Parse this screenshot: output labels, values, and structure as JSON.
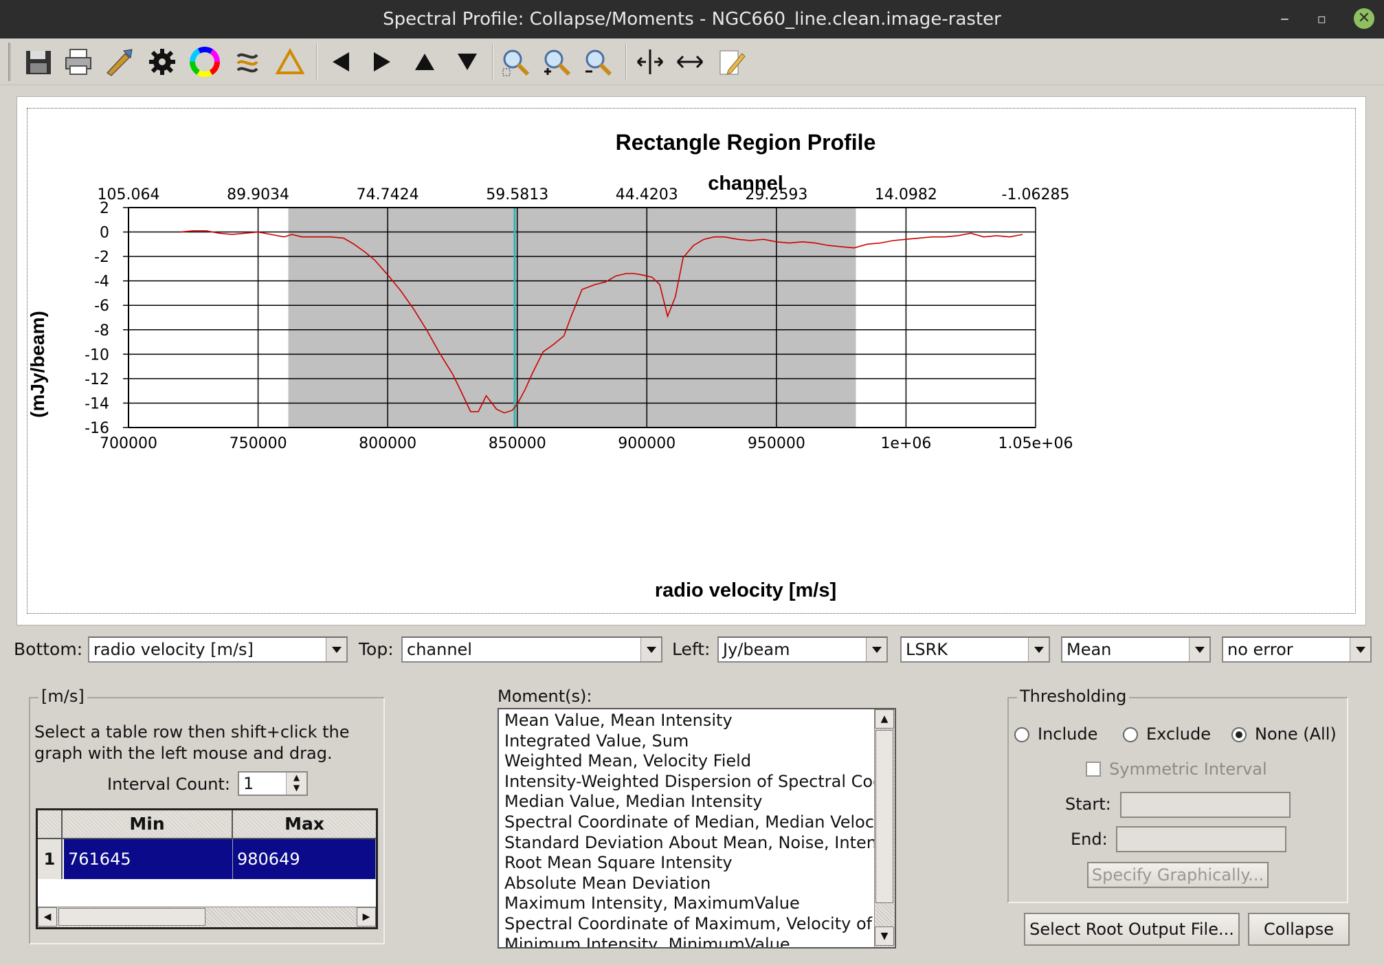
{
  "window": {
    "title": "Spectral Profile: Collapse/Moments - NGC660_line.clean.image-raster",
    "minimize": "–",
    "restore": "▫",
    "close": "✕"
  },
  "toolbar": {
    "icons": [
      "save-icon",
      "print-icon",
      "preferences-icon",
      "settings-gear-icon",
      "color-wheel-icon",
      "smooth-icon",
      "triangle-icon",
      "left-arrow-icon",
      "right-arrow-icon",
      "up-arrow-icon",
      "down-arrow-icon",
      "zoom-fit-icon",
      "zoom-in-icon",
      "zoom-out-icon",
      "pan-icon",
      "horizontal-arrows-icon",
      "edit-icon"
    ]
  },
  "chart_data": {
    "type": "line",
    "title": "Rectangle Region Profile",
    "top_axis_label": "channel",
    "xlabel": "radio velocity [m/s]",
    "ylabel": "(mJy/beam)",
    "xlim": [
      700000,
      1050000
    ],
    "ylim": [
      -16,
      2
    ],
    "x_ticks": [
      "700000",
      "750000",
      "800000",
      "850000",
      "900000",
      "950000",
      "1e+06",
      "1.05e+06"
    ],
    "x_tick_values": [
      700000,
      750000,
      800000,
      850000,
      900000,
      950000,
      1000000,
      1050000
    ],
    "top_ticks": [
      "105.064",
      "89.9034",
      "74.7424",
      "59.5813",
      "44.4203",
      "29.2593",
      "14.0982",
      "-1.06285"
    ],
    "y_ticks": [
      "2",
      "0",
      "-2",
      "-4",
      "-6",
      "-8",
      "-10",
      "-12",
      "-14",
      "-16"
    ],
    "y_tick_values": [
      2,
      0,
      -2,
      -4,
      -6,
      -8,
      -10,
      -12,
      -14,
      -16
    ],
    "shaded_interval": [
      761645,
      980649
    ],
    "marker_x": 849000,
    "series": [
      {
        "color": "#cc0000",
        "x": [
          720000,
          725000,
          730000,
          735000,
          740000,
          745000,
          750000,
          755000,
          760000,
          763000,
          767000,
          772000,
          778000,
          783000,
          787000,
          791000,
          795000,
          800000,
          805000,
          810000,
          815000,
          820000,
          825000,
          828000,
          832000,
          835000,
          838000,
          842000,
          845000,
          848000,
          850000,
          853000,
          856000,
          860000,
          864000,
          868000,
          871000,
          875000,
          880000,
          884000,
          888000,
          892000,
          895000,
          898000,
          902000,
          905000,
          908000,
          911000,
          914000,
          918000,
          922000,
          926000,
          930000,
          935000,
          940000,
          945000,
          950000,
          955000,
          960000,
          965000,
          970000,
          975000,
          980000,
          985000,
          990000,
          995000,
          1000000,
          1005000,
          1010000,
          1015000,
          1020000,
          1025000,
          1030000,
          1035000,
          1040000,
          1045000
        ],
        "y": [
          0,
          0.1,
          0.1,
          -0.1,
          -0.2,
          -0.1,
          0.0,
          -0.2,
          -0.4,
          -0.2,
          -0.4,
          -0.4,
          -0.4,
          -0.5,
          -1.0,
          -1.6,
          -2.3,
          -3.5,
          -4.8,
          -6.3,
          -8.0,
          -9.9,
          -11.6,
          -12.9,
          -14.7,
          -14.7,
          -13.4,
          -14.5,
          -14.8,
          -14.6,
          -14.1,
          -12.9,
          -11.5,
          -9.8,
          -9.2,
          -8.5,
          -6.8,
          -4.7,
          -4.3,
          -4.1,
          -3.6,
          -3.4,
          -3.4,
          -3.5,
          -3.7,
          -4.3,
          -6.9,
          -5.3,
          -2.1,
          -1.1,
          -0.6,
          -0.4,
          -0.4,
          -0.6,
          -0.7,
          -0.6,
          -0.8,
          -0.9,
          -0.8,
          -0.9,
          -1.1,
          -1.2,
          -1.3,
          -1.0,
          -0.9,
          -0.7,
          -0.6,
          -0.5,
          -0.4,
          -0.4,
          -0.3,
          -0.1,
          -0.4,
          -0.3,
          -0.4,
          -0.2
        ]
      }
    ],
    "grid": true
  },
  "controls": {
    "bottom_label": "Bottom:",
    "bottom_value": "radio velocity [m/s]",
    "top_label": "Top:",
    "top_value": "channel",
    "left_label": "Left:",
    "left_value": "Jy/beam",
    "frame_value": "LSRK",
    "stat_value": "Mean",
    "error_value": "no error"
  },
  "interval_group": {
    "title": "[m/s]",
    "instructions": "Select a table row then shift+click the graph with the left mouse and drag.",
    "count_label": "Interval Count:",
    "count_value": "1",
    "col_min": "Min",
    "col_max": "Max",
    "rows": [
      {
        "index": "1",
        "min": "761645",
        "max": "980649"
      }
    ]
  },
  "moments": {
    "label": "Moment(s):",
    "items": [
      "Mean Value, Mean Intensity",
      "Integrated Value, Sum",
      "Weighted Mean, Velocity Field",
      "Intensity-Weighted Dispersion of Spectral Coo",
      "Median Value, Median Intensity",
      "Spectral Coordinate of Median, Median Velocit",
      "Standard Deviation About Mean, Noise, Intens",
      "Root Mean Square Intensity",
      "Absolute Mean Deviation",
      "Maximum Intensity, MaximumValue",
      "Spectral Coordinate of Maximum, Velocity of I",
      "Minimum Intensity, MinimumValue"
    ]
  },
  "thresholding": {
    "title": "Thresholding",
    "include": "Include",
    "exclude": "Exclude",
    "none": "None (All)",
    "symmetric": "Symmetric Interval",
    "start_label": "Start:",
    "end_label": "End:",
    "specify": "Specify Graphically..."
  },
  "buttons": {
    "select_root": "Select Root Output File...",
    "collapse": "Collapse"
  }
}
